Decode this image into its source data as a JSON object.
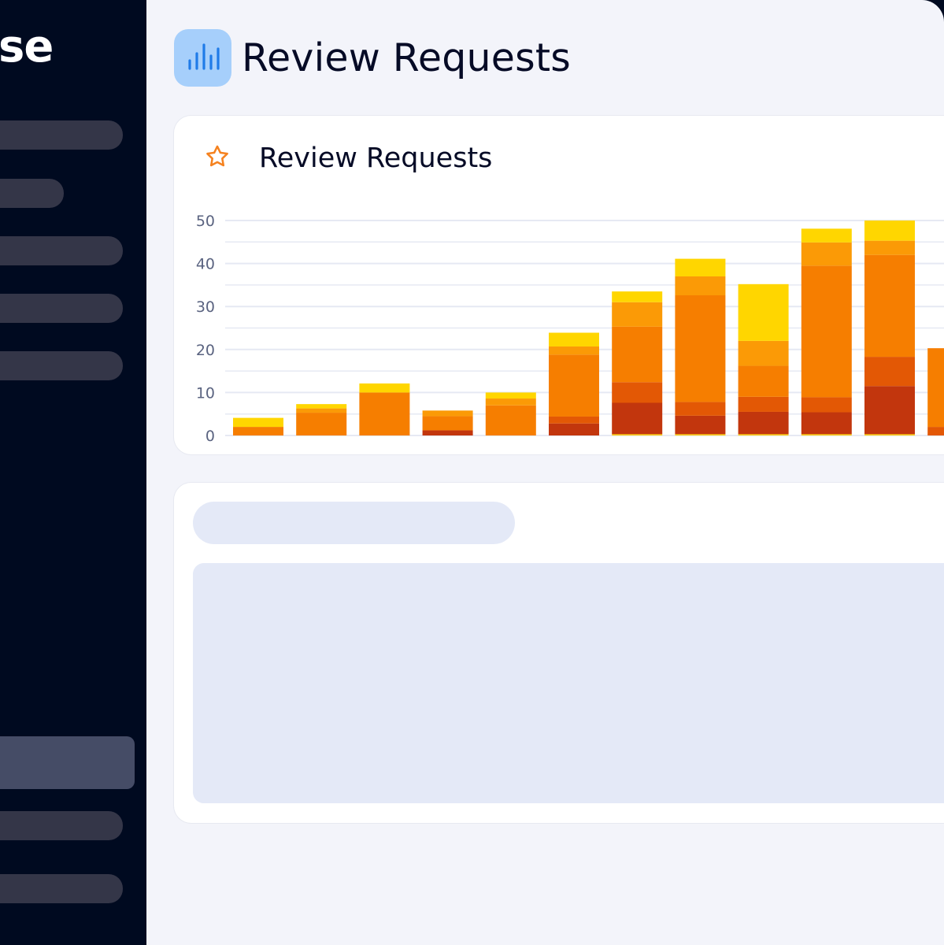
{
  "app": {
    "brand_fragment": "se"
  },
  "sidebar": {
    "items": [
      {
        "id": "nav-1",
        "active": false
      },
      {
        "id": "nav-2",
        "active": false
      },
      {
        "id": "nav-3",
        "active": false
      },
      {
        "id": "nav-4",
        "active": false
      },
      {
        "id": "nav-5",
        "active": false
      },
      {
        "id": "nav-6",
        "active": true
      },
      {
        "id": "nav-7",
        "active": false
      },
      {
        "id": "nav-8",
        "active": false
      }
    ]
  },
  "header": {
    "title": "Review Requests",
    "icon": "bar-chart-icon",
    "icon_bg": "#a6cffb",
    "icon_color": "#1f7be8"
  },
  "chart_card": {
    "title": "Review Requests",
    "icon": "star-icon",
    "icon_color": "#f5821f"
  },
  "chart_data": {
    "type": "bar",
    "stacked": true,
    "title": "",
    "xlabel": "",
    "ylabel": "",
    "ylim": [
      0,
      50
    ],
    "yticks": [
      0,
      10,
      20,
      30,
      40,
      50
    ],
    "grid": true,
    "categories": [
      "",
      "",
      "",
      "",
      "",
      "",
      "",
      "",
      "",
      "",
      "",
      ""
    ],
    "series": [
      {
        "color": "#fccf0b",
        "values": [
          0,
          0,
          0,
          0,
          0,
          0,
          0.3,
          0.3,
          0.3,
          0.3,
          0.3,
          0
        ]
      },
      {
        "color": "#c2360d",
        "values": [
          0,
          0,
          0,
          1.2,
          0,
          2.8,
          7.3,
          4.3,
          5.2,
          5.1,
          11.2,
          0
        ]
      },
      {
        "color": "#e35805",
        "values": [
          0,
          0,
          0,
          0,
          0,
          1.6,
          4.8,
          3.2,
          3.5,
          3.5,
          6.8,
          2.0
        ]
      },
      {
        "color": "#f67e00",
        "values": [
          2.0,
          5.3,
          10.0,
          3.3,
          7.0,
          14.4,
          12.9,
          24.8,
          7.2,
          30.6,
          23.7,
          18.3
        ]
      },
      {
        "color": "#fb9a06",
        "values": [
          0,
          1.0,
          0,
          1.3,
          1.6,
          1.9,
          5.7,
          4.4,
          5.8,
          5.4,
          3.3,
          0
        ]
      },
      {
        "color": "#ffd600",
        "values": [
          2.1,
          1.0,
          2.1,
          0,
          1.4,
          3.2,
          2.5,
          4.1,
          13.2,
          3.2,
          4.7,
          0
        ]
      }
    ]
  },
  "skeleton_card": {
    "loading": true
  }
}
